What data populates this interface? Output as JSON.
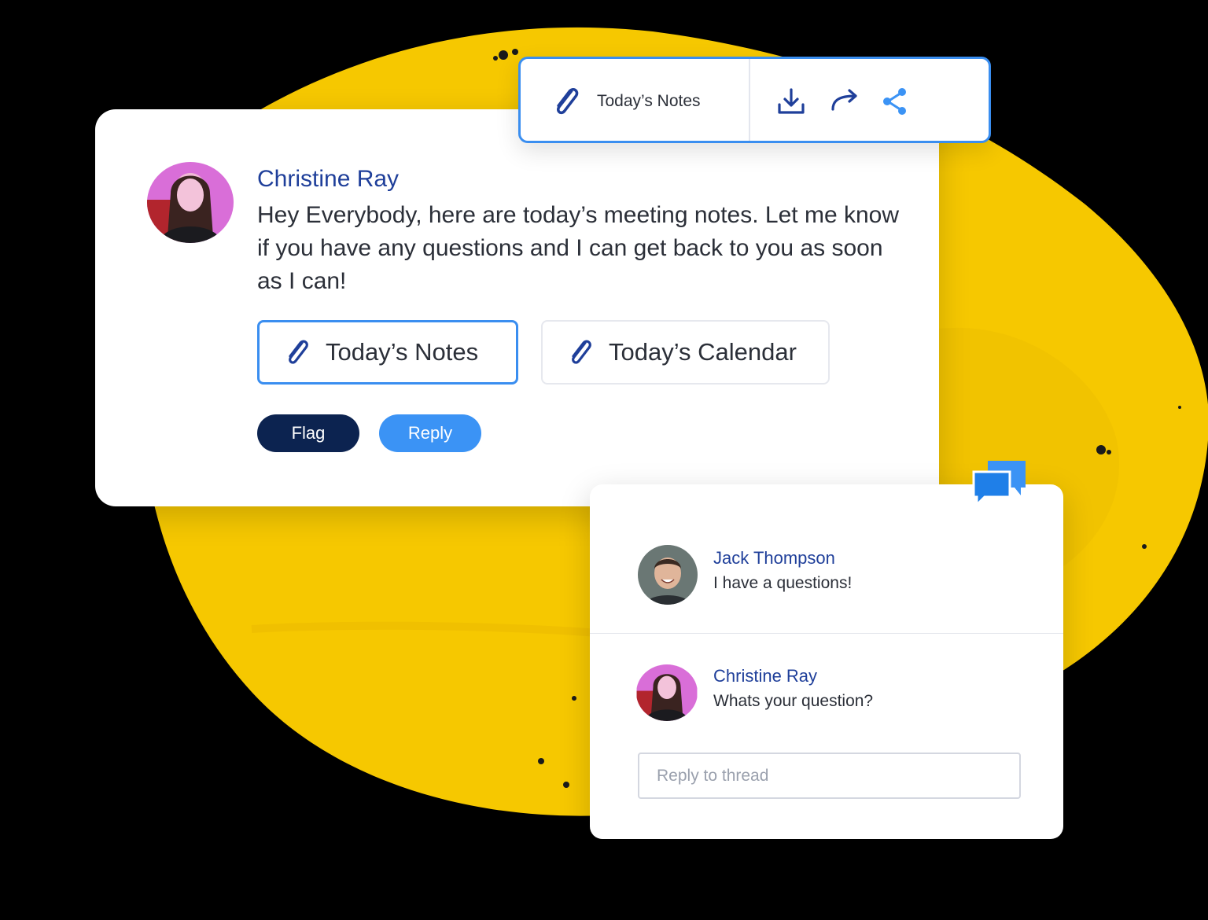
{
  "colors": {
    "background": "#000000",
    "blob": "#f6c800",
    "accent_blue": "#3b93f5",
    "name_blue": "#1f3f9a",
    "flag_navy": "#0c2350"
  },
  "toolbar": {
    "attachment_label": "Today’s Notes",
    "icons": [
      "paperclip-icon",
      "download-icon",
      "forward-icon",
      "share-icon"
    ]
  },
  "message": {
    "sender": "Christine Ray",
    "text": "Hey Everybody, here are today’s meeting notes. Let me know if you have any questions and I can get back to you as soon as I can!",
    "attachments": [
      {
        "label": "Today’s Notes",
        "selected": true
      },
      {
        "label": "Today’s Calendar",
        "selected": false
      }
    ],
    "flag_label": "Flag",
    "reply_label": "Reply"
  },
  "thread": {
    "icon": "chat-bubbles-icon",
    "replies": [
      {
        "name": "Jack Thompson",
        "text": "I have a questions!"
      },
      {
        "name": "Christine Ray",
        "text": "Whats your question?"
      }
    ],
    "input": {
      "placeholder": "Reply to thread",
      "value": ""
    }
  }
}
